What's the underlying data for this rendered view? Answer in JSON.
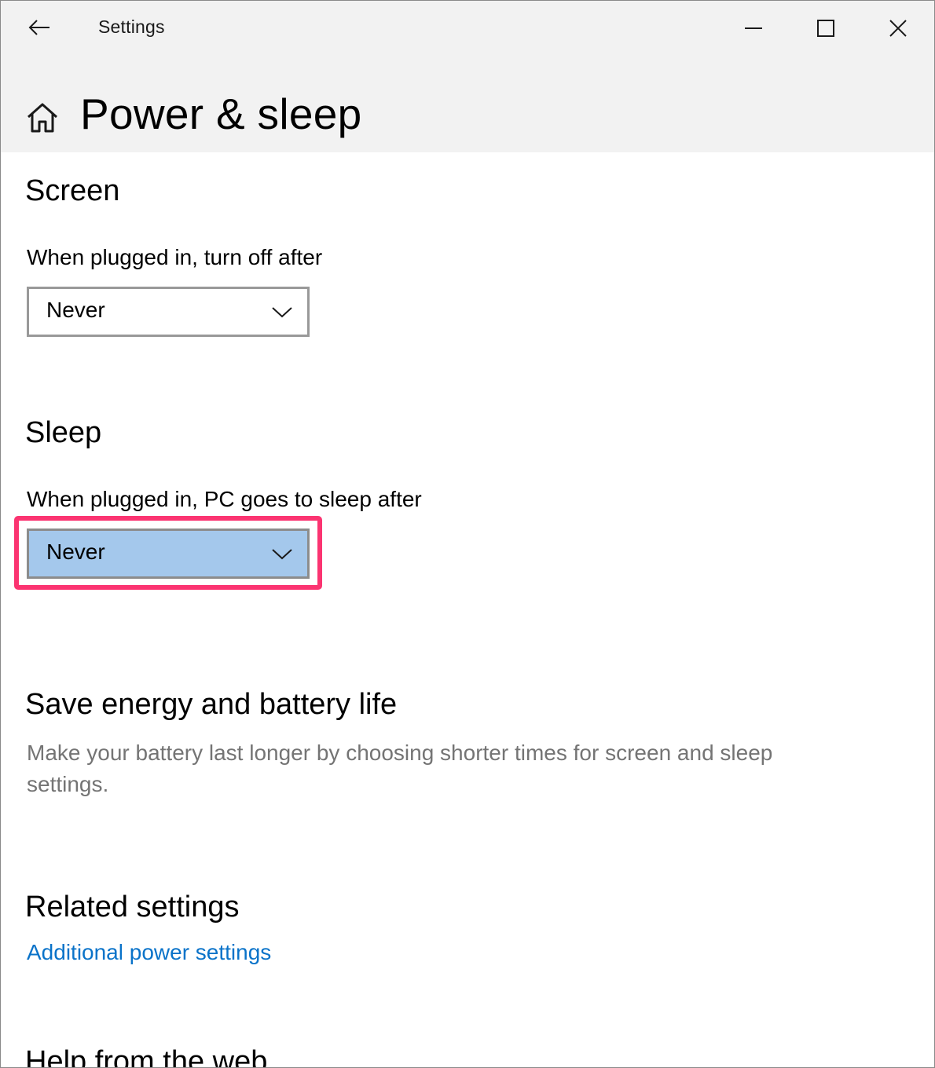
{
  "window": {
    "app_title": "Settings",
    "back_icon": "back-arrow-icon",
    "controls": {
      "minimize_icon": "minimize-icon",
      "maximize_icon": "maximize-icon",
      "close_icon": "close-icon"
    }
  },
  "header": {
    "home_icon": "home-icon",
    "title": "Power & sleep"
  },
  "screen": {
    "heading": "Screen",
    "plugged_in_label": "When plugged in, turn off after",
    "plugged_in_value": "Never"
  },
  "sleep": {
    "heading": "Sleep",
    "plugged_in_label": "When plugged in, PC goes to sleep after",
    "plugged_in_value": "Never"
  },
  "save_energy": {
    "heading": "Save energy and battery life",
    "description": "Make your battery last longer by choosing shorter times for screen and sleep settings."
  },
  "related": {
    "heading": "Related settings",
    "link": "Additional power settings"
  },
  "help": {
    "heading": "Help from the web"
  },
  "colors": {
    "accent_link": "#0a73c9",
    "selected_dropdown": "#a4c8ec",
    "annotation_highlight": "#fb3471",
    "titlebar_bg": "#f2f2f2"
  }
}
